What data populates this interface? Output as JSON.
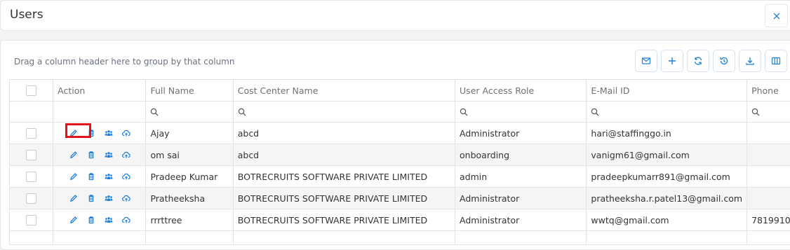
{
  "page": {
    "title": "Users"
  },
  "grid": {
    "group_hint": "Drag a column header here to group by that column",
    "columns": [
      "Action",
      "Full Name",
      "Cost Center Name",
      "User Access Role",
      "E-Mail ID",
      "Phone"
    ],
    "rows": [
      {
        "full_name": "Ajay",
        "cost_center": "abcd",
        "role": "Administrator",
        "email": "hari@staffinggo.in",
        "phone": ""
      },
      {
        "full_name": "om sai",
        "cost_center": "abcd",
        "role": "onboarding",
        "email": "vanigm61@gmail.com",
        "phone": ""
      },
      {
        "full_name": "Pradeep Kumar",
        "cost_center": "BOTRECRUITS SOFTWARE PRIVATE LIMITED",
        "role": "admin",
        "email": "pradeepkumarr891@gmail.com",
        "phone": ""
      },
      {
        "full_name": "Pratheeksha",
        "cost_center": "BOTRECRUITS SOFTWARE PRIVATE LIMITED",
        "role": "Administrator",
        "email": "pratheeksha.r.patel13@gmail.com",
        "phone": ""
      },
      {
        "full_name": "rrrttree",
        "cost_center": "BOTRECRUITS SOFTWARE PRIVATE LIMITED",
        "role": "Administrator",
        "email": "wwtq@gmail.com",
        "phone": "7819910"
      }
    ]
  },
  "icons": {
    "close": "close-icon",
    "toolbar": [
      "mail-icon",
      "plus-icon",
      "refresh-icon",
      "history-icon",
      "download-icon",
      "columns-icon"
    ],
    "row_actions": [
      "edit-icon",
      "delete-icon",
      "users-icon",
      "cloud-upload-icon"
    ]
  },
  "colors": {
    "accent": "#1e7fd8",
    "highlight": "#e2141a"
  }
}
